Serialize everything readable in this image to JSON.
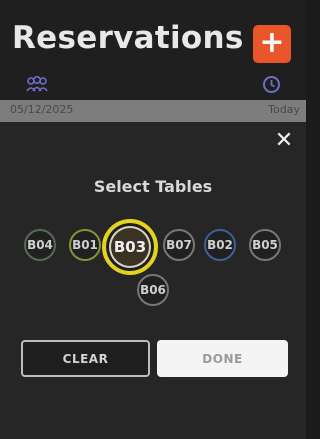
{
  "header": {
    "title": "Reservations",
    "add_label": "+",
    "guests_icon": "users-icon",
    "clock_icon": "clock-icon"
  },
  "date_bar": {
    "date": "05/12/2025",
    "today_label": "Today"
  },
  "modal": {
    "close_label": "✕",
    "title": "Select Tables",
    "tables": [
      {
        "label": "B04",
        "selected": false
      },
      {
        "label": "B01",
        "selected": false
      },
      {
        "label": "B03",
        "selected": true
      },
      {
        "label": "B07",
        "selected": false
      },
      {
        "label": "B02",
        "selected": false
      },
      {
        "label": "B05",
        "selected": false
      },
      {
        "label": "B06",
        "selected": false
      }
    ],
    "clear_label": "CLEAR",
    "done_label": "DONE"
  },
  "colors": {
    "accent": "#e8562a",
    "selected_ring": "#e4d21e",
    "background": "#1b1b1b"
  }
}
